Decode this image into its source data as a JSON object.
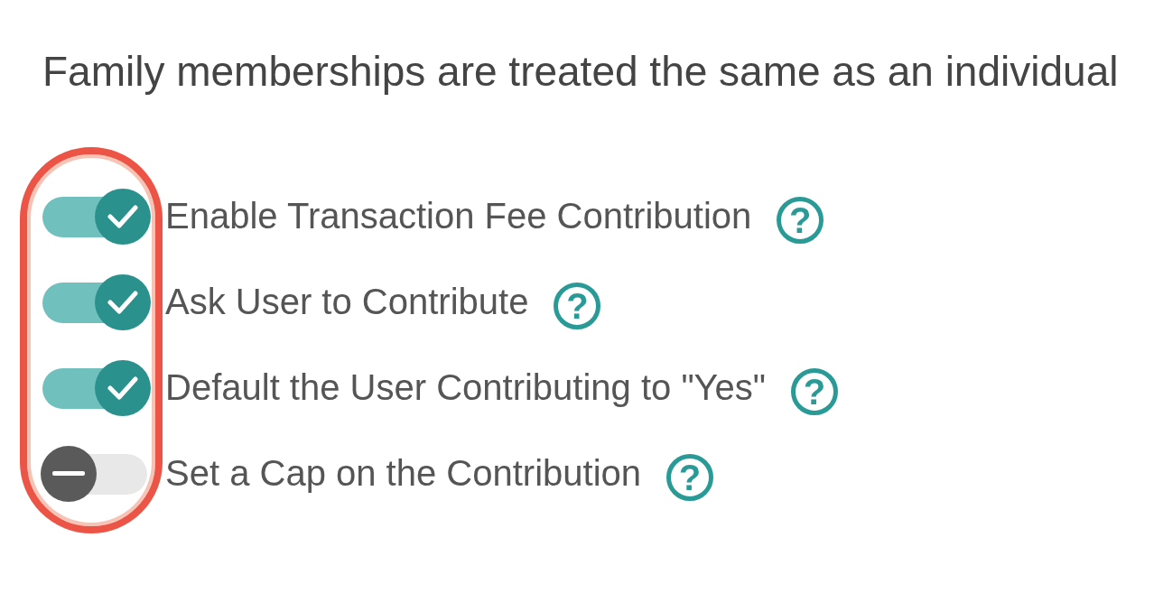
{
  "intro": "Family memberships are treated the same as an individual",
  "settings": [
    {
      "label": "Enable Transaction Fee Contribution",
      "on": true,
      "help": "?"
    },
    {
      "label": "Ask User to Contribute",
      "on": true,
      "help": "?"
    },
    {
      "label": "Default the User Contributing to \"Yes\"",
      "on": true,
      "help": "?"
    },
    {
      "label": "Set a Cap on the Contribution",
      "on": false,
      "help": "?"
    }
  ],
  "highlight": {
    "shown": true
  }
}
